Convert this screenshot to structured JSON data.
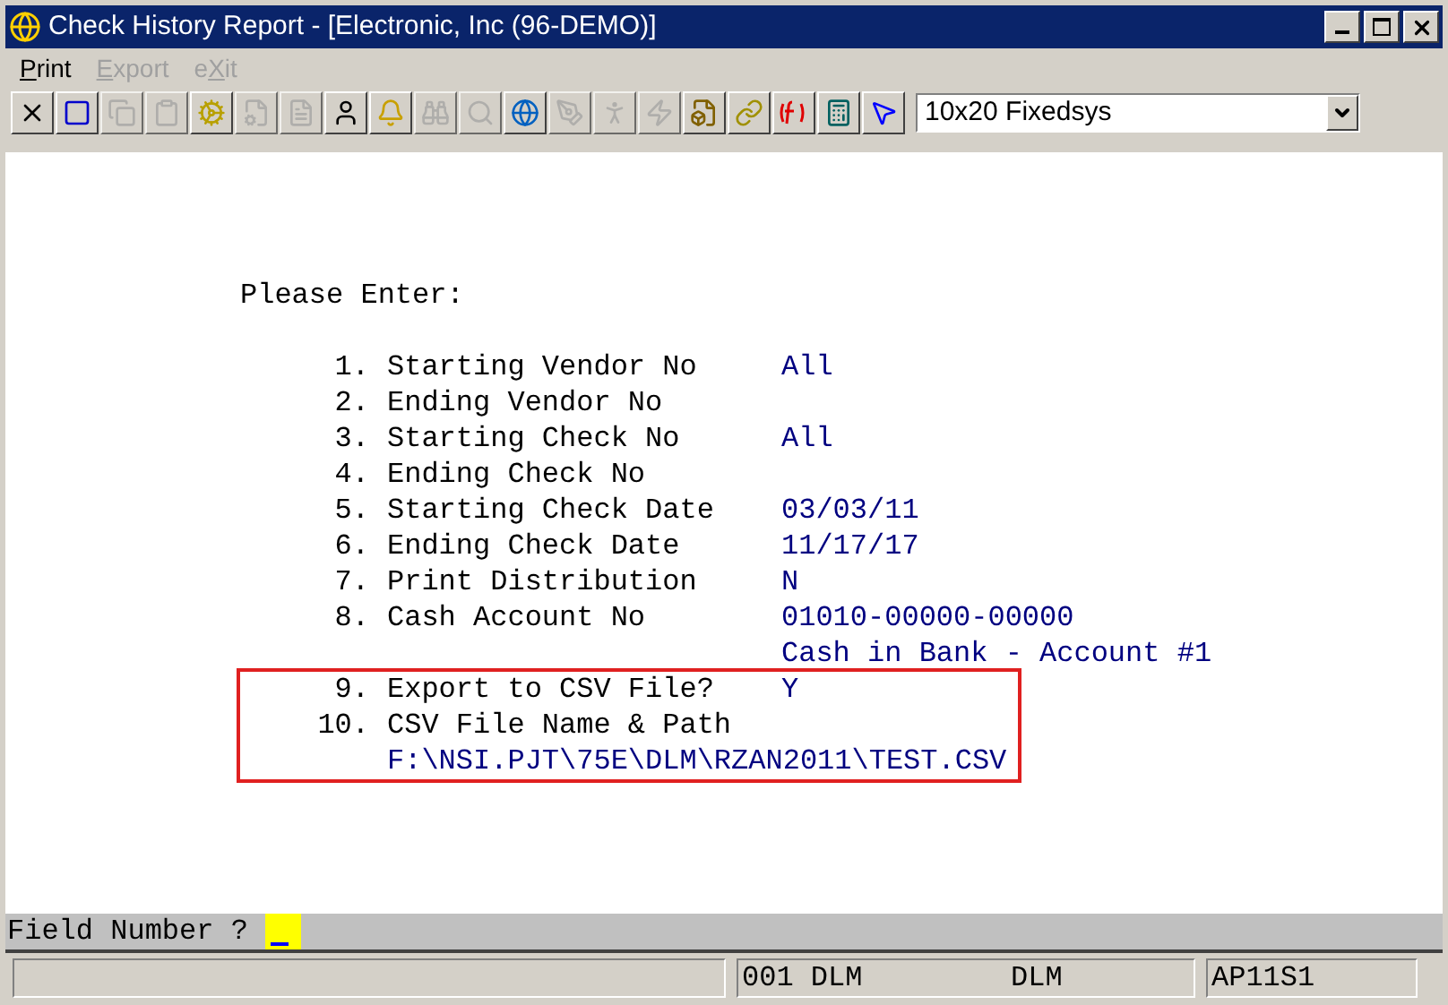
{
  "window": {
    "title": "Check History Report - [Electronic, Inc (96-DEMO)]"
  },
  "menu": [
    {
      "key": "P",
      "after": "rint",
      "disabled": false
    },
    {
      "key": "E",
      "after": "xport",
      "disabled": true
    },
    {
      "before": "e",
      "key": "X",
      "after": "it",
      "disabled": true
    }
  ],
  "toolbar": [
    {
      "kind": "close",
      "disabled": false
    },
    {
      "kind": "select",
      "disabled": false
    },
    {
      "kind": "copy",
      "disabled": true
    },
    {
      "kind": "paste",
      "disabled": true
    },
    {
      "kind": "gear",
      "disabled": false
    },
    {
      "kind": "properties",
      "disabled": true
    },
    {
      "kind": "list",
      "disabled": true
    },
    {
      "kind": "person",
      "disabled": false
    },
    {
      "kind": "bell",
      "disabled": false
    },
    {
      "kind": "binoculars",
      "disabled": true
    },
    {
      "kind": "search",
      "disabled": true
    },
    {
      "kind": "globe",
      "disabled": false
    },
    {
      "kind": "script",
      "disabled": true
    },
    {
      "kind": "figure",
      "disabled": true
    },
    {
      "kind": "bolt",
      "disabled": true
    },
    {
      "kind": "boltdoc",
      "disabled": false
    },
    {
      "kind": "link",
      "disabled": false
    },
    {
      "kind": "function",
      "disabled": false
    },
    {
      "kind": "calculator",
      "disabled": false
    },
    {
      "kind": "help",
      "disabled": false
    }
  ],
  "font_select": {
    "value": "10x20 Fixedsys"
  },
  "form": {
    "heading": "Please Enter:",
    "fields": [
      {
        "number": "1.",
        "label": "Starting Vendor No",
        "value": "All"
      },
      {
        "number": "2.",
        "label": "Ending Vendor No"
      },
      {
        "number": "3.",
        "label": "Starting Check No",
        "value": "All"
      },
      {
        "number": "4.",
        "label": "Ending Check No"
      },
      {
        "number": "5.",
        "label": "Starting Check Date",
        "value": "03/03/11"
      },
      {
        "number": "6.",
        "label": "Ending Check Date",
        "value": "11/17/17"
      },
      {
        "number": "7.",
        "label": "Print Distribution",
        "value": "N"
      },
      {
        "number": "8.",
        "label": "Cash Account No",
        "value": "01010-00000-00000",
        "value_line2": "Cash in Bank - Account #1"
      },
      {
        "number": "9.",
        "label": "Export to CSV File?",
        "value": "Y",
        "highlighted": true
      },
      {
        "number": "10.",
        "label": "CSV File Name & Path",
        "path": "F:\\NSI.PJT\\75E\\DLM\\RZAN2011\\TEST.CSV",
        "highlighted": true
      }
    ]
  },
  "prompt": {
    "label": "Field Number ?"
  },
  "status_bar": {
    "panel_2a": "001 DLM",
    "panel_2b": "DLM",
    "panel_3": "AP11S1"
  }
}
